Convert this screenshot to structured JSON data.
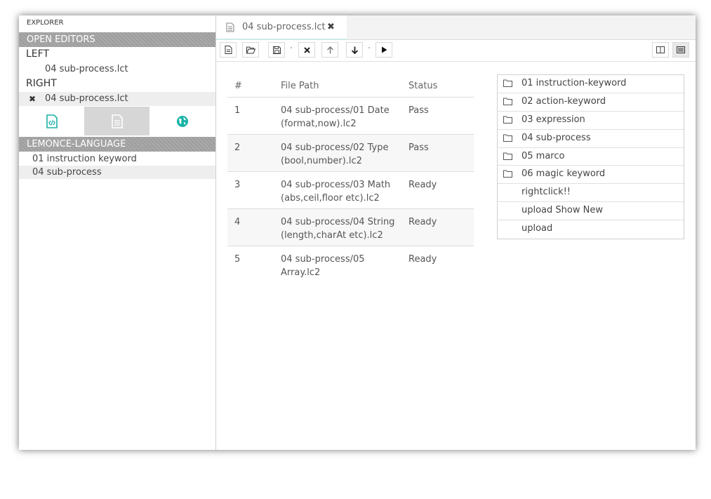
{
  "explorer": {
    "title": "EXPLORER"
  },
  "open_editors": {
    "header": "OPEN EDITORS",
    "left_label": "LEFT",
    "left_item": "04 sub-process.lct",
    "right_label": "RIGHT",
    "right_item": "04 sub-process.lct",
    "close_glyph": "✖"
  },
  "sidebar_tabs": [
    {
      "icon": "code-file-icon",
      "color": "#19b3a6"
    },
    {
      "icon": "document-icon",
      "color": "#ffffff"
    },
    {
      "icon": "globe-icon",
      "color": "#19b3a6"
    }
  ],
  "language": {
    "header": "LEMONCE-LANGUAGE",
    "items": [
      "01 instruction keyword",
      "04 sub-process"
    ]
  },
  "editor_tab": {
    "title": "04 sub-process.lct",
    "close_glyph": "✖"
  },
  "toolbar": {
    "buttons": [
      "new-file-icon",
      "open-folder-icon",
      "save-icon",
      "delete-icon",
      "move-up-icon",
      "move-down-icon",
      "run-icon"
    ],
    "right_buttons": [
      "split-view-icon",
      "panel-view-icon"
    ]
  },
  "table": {
    "headers": [
      "#",
      "File Path",
      "Status"
    ],
    "rows": [
      {
        "num": "1",
        "path_line1": "04 sub-process/01 Date",
        "path_line2": "(format,now).lc2",
        "status": "Pass"
      },
      {
        "num": "2",
        "path_line1": "04 sub-process/02 Type",
        "path_line2": "(bool,number).lc2",
        "status": "Pass"
      },
      {
        "num": "3",
        "path_line1": "04 sub-process/03 Math",
        "path_line2": "(abs,ceil,floor etc).lc2",
        "status": "Ready"
      },
      {
        "num": "4",
        "path_line1": "04 sub-process/04 String",
        "path_line2": "(length,charAt etc).lc2",
        "status": "Ready"
      },
      {
        "num": "5",
        "path_line1": "04 sub-process/05",
        "path_line2": "Array.lc2",
        "status": "Ready"
      }
    ]
  },
  "folders": {
    "items": [
      {
        "label": "01 instruction-keyword",
        "icon": "folder-icon"
      },
      {
        "label": "02 action-keyword",
        "icon": "folder-icon"
      },
      {
        "label": "03 expression",
        "icon": "folder-icon"
      },
      {
        "label": "04 sub-process",
        "icon": "folder-icon"
      },
      {
        "label": "05 marco",
        "icon": "folder-icon"
      },
      {
        "label": "06 magic keyword",
        "icon": "folder-icon"
      },
      {
        "label": "rightclick!!",
        "icon": ""
      },
      {
        "label": "upload Show New",
        "icon": ""
      },
      {
        "label": "upload",
        "icon": ""
      }
    ]
  }
}
